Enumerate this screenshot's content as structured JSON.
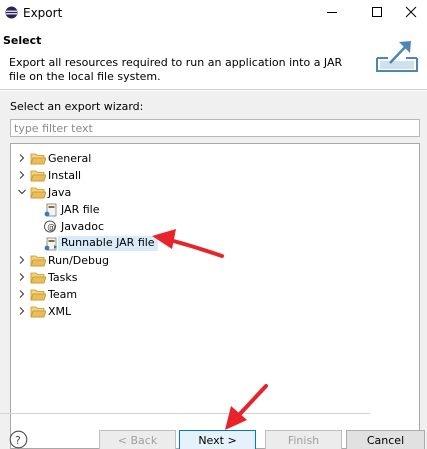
{
  "window": {
    "title": "Export",
    "controls": [
      "minimize-icon",
      "maximize-icon",
      "close-icon"
    ]
  },
  "header": {
    "title": "Select",
    "description": "Export all resources required to run an application into a JAR file on the local file system."
  },
  "wizard": {
    "label": "Select an export wizard:",
    "filter_placeholder": "type filter text",
    "filter_value": ""
  },
  "tree": {
    "items": [
      {
        "label": "General",
        "expanded": false,
        "icon": "folder-icon"
      },
      {
        "label": "Install",
        "expanded": false,
        "icon": "folder-icon"
      },
      {
        "label": "Java",
        "expanded": true,
        "icon": "folder-icon",
        "children": [
          {
            "label": "JAR file",
            "icon": "jar-file-icon"
          },
          {
            "label": "Javadoc",
            "icon": "javadoc-icon"
          },
          {
            "label": "Runnable JAR file",
            "icon": "runnable-jar-icon",
            "selected": true
          }
        ]
      },
      {
        "label": "Run/Debug",
        "expanded": false,
        "icon": "folder-icon"
      },
      {
        "label": "Tasks",
        "expanded": false,
        "icon": "folder-icon"
      },
      {
        "label": "Team",
        "expanded": false,
        "icon": "folder-icon"
      },
      {
        "label": "XML",
        "expanded": false,
        "icon": "folder-icon"
      }
    ]
  },
  "buttons": {
    "back": "< Back",
    "next": "Next >",
    "finish": "Finish",
    "cancel": "Cancel"
  },
  "colors": {
    "selection": "#d9ebf9",
    "annotation_arrow": "#e8232a",
    "folder": "#e9bd5a",
    "default_button_border": "#0078d7"
  }
}
